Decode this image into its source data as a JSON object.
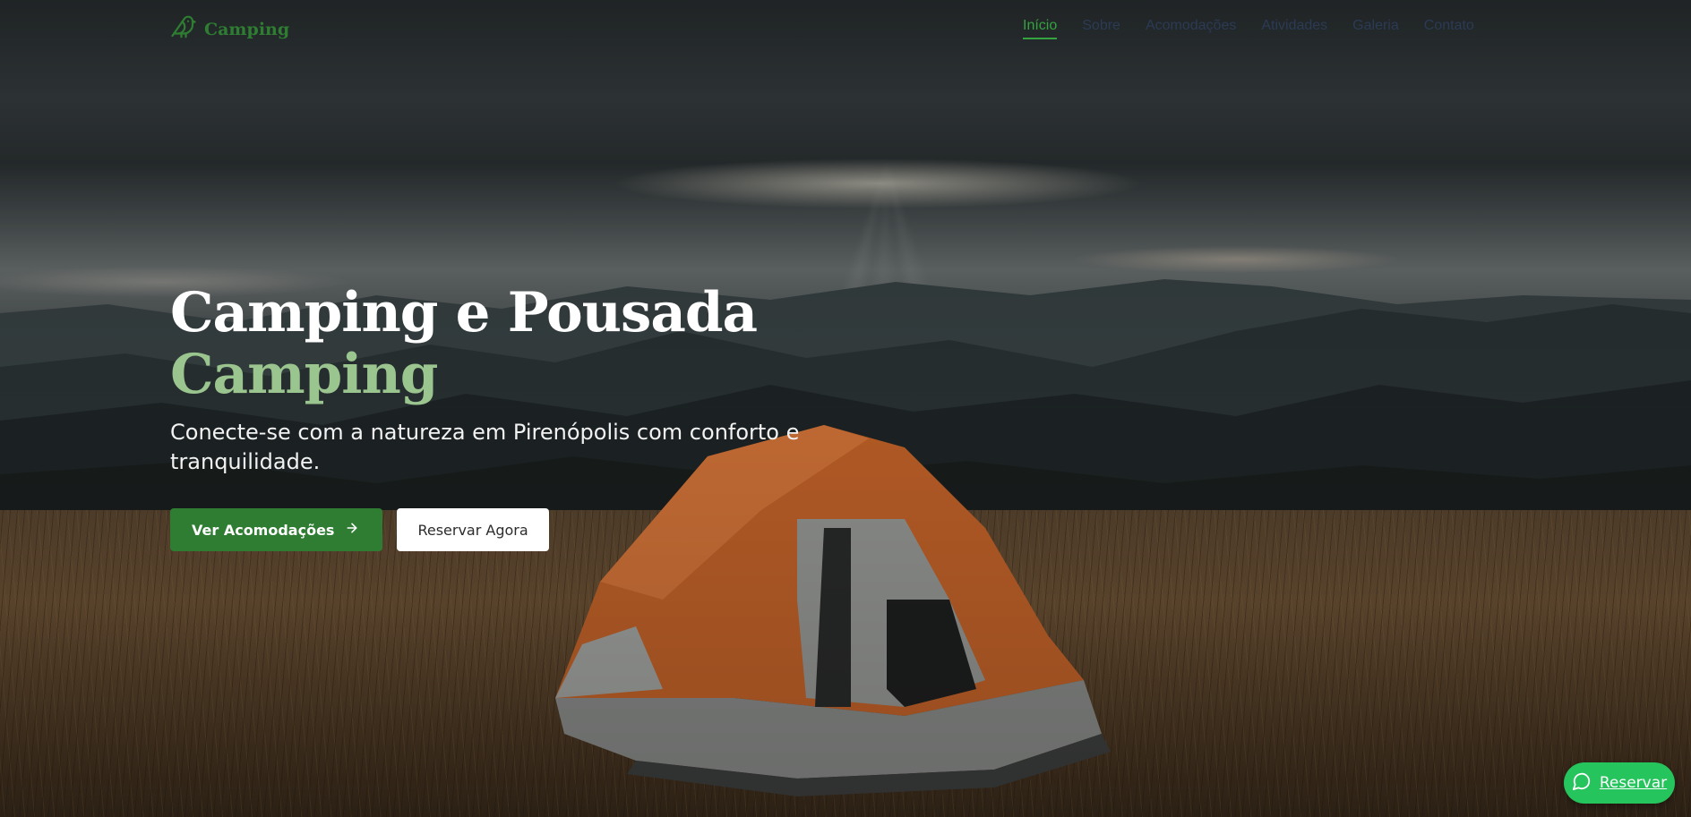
{
  "brand": {
    "name": "Camping",
    "logo_icon": "bird-icon",
    "color": "#2e7d32"
  },
  "nav": {
    "items": [
      {
        "label": "Início",
        "active": true
      },
      {
        "label": "Sobre",
        "active": false
      },
      {
        "label": "Acomodações",
        "active": false
      },
      {
        "label": "Atividades",
        "active": false
      },
      {
        "label": "Galeria",
        "active": false
      },
      {
        "label": "Contato",
        "active": false
      }
    ],
    "active_color": "#35a33f",
    "text_color": "#2b3a55"
  },
  "hero": {
    "title_line1": "Camping e Pousada",
    "title_line2": "Camping",
    "subtitle": "Conecte-se com a natureza em Pirenópolis com conforto e tranquilidade.",
    "accent_color": "#9bc58f",
    "background_image": "camping-tent-mountains-photo"
  },
  "cta": {
    "primary_label": "Ver Acomodações",
    "primary_icon": "arrow-right-icon",
    "secondary_label": "Reservar Agora"
  },
  "floating_button": {
    "label": "Reservar",
    "icon": "chat-bubble-icon",
    "color": "#25c45c"
  }
}
